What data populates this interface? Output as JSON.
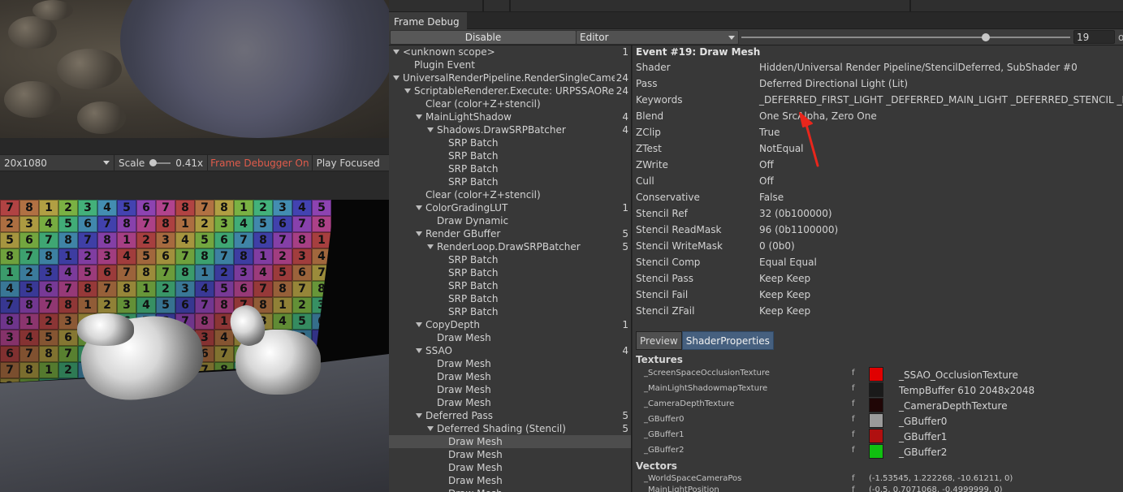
{
  "game_toolbar": {
    "resolution": "20x1080",
    "scale_label": "Scale",
    "scale_value": "0.41x",
    "frame_debugger_status": "Frame Debugger On",
    "play_mode": "Play Focused"
  },
  "wall_numbers": [
    "7",
    "8",
    "1",
    "2",
    "3",
    "4",
    "5",
    "6",
    "7",
    "8"
  ],
  "window": {
    "tab_title": "Frame Debug",
    "disable_label": "Disable",
    "target": "Editor",
    "event_index": "19",
    "event_count_fragment": "o"
  },
  "tree": [
    {
      "label": "<unknown scope>",
      "count": "1",
      "depth": 0,
      "arrow": true
    },
    {
      "label": "Plugin Event",
      "count": "",
      "depth": 1,
      "arrow": false
    },
    {
      "label": "UniversalRenderPipeline.RenderSingleCamera",
      "count": "24",
      "depth": 0,
      "arrow": true
    },
    {
      "label": "ScriptableRenderer.Execute: URPSSAORenderer",
      "count": "24",
      "depth": 1,
      "arrow": true
    },
    {
      "label": "Clear (color+Z+stencil)",
      "count": "",
      "depth": 2,
      "arrow": false
    },
    {
      "label": "MainLightShadow",
      "count": "4",
      "depth": 2,
      "arrow": true
    },
    {
      "label": "Shadows.DrawSRPBatcher",
      "count": "4",
      "depth": 3,
      "arrow": true
    },
    {
      "label": "SRP Batch",
      "count": "",
      "depth": 4,
      "arrow": false
    },
    {
      "label": "SRP Batch",
      "count": "",
      "depth": 4,
      "arrow": false
    },
    {
      "label": "SRP Batch",
      "count": "",
      "depth": 4,
      "arrow": false
    },
    {
      "label": "SRP Batch",
      "count": "",
      "depth": 4,
      "arrow": false
    },
    {
      "label": "Clear (color+Z+stencil)",
      "count": "",
      "depth": 2,
      "arrow": false
    },
    {
      "label": "ColorGradingLUT",
      "count": "1",
      "depth": 2,
      "arrow": true
    },
    {
      "label": "Draw Dynamic",
      "count": "",
      "depth": 3,
      "arrow": false
    },
    {
      "label": "Render GBuffer",
      "count": "5",
      "depth": 2,
      "arrow": true
    },
    {
      "label": "RenderLoop.DrawSRPBatcher",
      "count": "5",
      "depth": 3,
      "arrow": true
    },
    {
      "label": "SRP Batch",
      "count": "",
      "depth": 4,
      "arrow": false
    },
    {
      "label": "SRP Batch",
      "count": "",
      "depth": 4,
      "arrow": false
    },
    {
      "label": "SRP Batch",
      "count": "",
      "depth": 4,
      "arrow": false
    },
    {
      "label": "SRP Batch",
      "count": "",
      "depth": 4,
      "arrow": false
    },
    {
      "label": "SRP Batch",
      "count": "",
      "depth": 4,
      "arrow": false
    },
    {
      "label": "CopyDepth",
      "count": "1",
      "depth": 2,
      "arrow": true
    },
    {
      "label": "Draw Mesh",
      "count": "",
      "depth": 3,
      "arrow": false
    },
    {
      "label": "SSAO",
      "count": "4",
      "depth": 2,
      "arrow": true
    },
    {
      "label": "Draw Mesh",
      "count": "",
      "depth": 3,
      "arrow": false
    },
    {
      "label": "Draw Mesh",
      "count": "",
      "depth": 3,
      "arrow": false
    },
    {
      "label": "Draw Mesh",
      "count": "",
      "depth": 3,
      "arrow": false
    },
    {
      "label": "Draw Mesh",
      "count": "",
      "depth": 3,
      "arrow": false
    },
    {
      "label": "Deferred Pass",
      "count": "5",
      "depth": 2,
      "arrow": true
    },
    {
      "label": "Deferred Shading (Stencil)",
      "count": "5",
      "depth": 3,
      "arrow": true
    },
    {
      "label": "Draw Mesh",
      "count": "",
      "depth": 4,
      "arrow": false,
      "selected": true
    },
    {
      "label": "Draw Mesh",
      "count": "",
      "depth": 4,
      "arrow": false
    },
    {
      "label": "Draw Mesh",
      "count": "",
      "depth": 4,
      "arrow": false
    },
    {
      "label": "Draw Mesh",
      "count": "",
      "depth": 4,
      "arrow": false
    },
    {
      "label": "Draw Mesh",
      "count": "",
      "depth": 4,
      "arrow": false
    }
  ],
  "details": {
    "title": "Event #19: Draw Mesh",
    "properties": [
      {
        "key": "Shader",
        "value": "Hidden/Universal Render Pipeline/StencilDeferred, SubShader #0"
      },
      {
        "key": "Pass",
        "value": "Deferred Directional Light (Lit)"
      },
      {
        "key": "Keywords",
        "value": "_DEFERRED_FIRST_LIGHT _DEFERRED_MAIN_LIGHT _DEFERRED_STENCIL _DIR"
      },
      {
        "key": "Blend",
        "value": "One SrcAlpha, Zero One"
      },
      {
        "key": "ZClip",
        "value": "True"
      },
      {
        "key": "ZTest",
        "value": "NotEqual"
      },
      {
        "key": "ZWrite",
        "value": "Off"
      },
      {
        "key": "Cull",
        "value": "Off"
      },
      {
        "key": "Conservative",
        "value": "False"
      },
      {
        "key": "Stencil Ref",
        "value": "32 (0b100000)"
      },
      {
        "key": "Stencil ReadMask",
        "value": "96 (0b1100000)"
      },
      {
        "key": "Stencil WriteMask",
        "value": "0 (0b0)"
      },
      {
        "key": "Stencil Comp",
        "value": "Equal Equal"
      },
      {
        "key": "Stencil Pass",
        "value": "Keep Keep"
      },
      {
        "key": "Stencil Fail",
        "value": "Keep Keep"
      },
      {
        "key": "Stencil ZFail",
        "value": "Keep Keep"
      }
    ],
    "tab_preview": "Preview",
    "tab_shader_properties": "ShaderProperties",
    "textures_heading": "Textures",
    "textures": [
      {
        "name": "_ScreenSpaceOcclusionTexture",
        "flag": "f",
        "value": "_SSAO_OcclusionTexture",
        "swatch": "#e00000"
      },
      {
        "name": "_MainLightShadowmapTexture",
        "flag": "f",
        "value": "TempBuffer 610 2048x2048",
        "swatch": "#1a1a1a"
      },
      {
        "name": "_CameraDepthTexture",
        "flag": "f",
        "value": "_CameraDepthTexture",
        "swatch": "#200606"
      },
      {
        "name": "_GBuffer0",
        "flag": "f",
        "value": "_GBuffer0",
        "swatch": "#9a9a9a"
      },
      {
        "name": "_GBuffer1",
        "flag": "f",
        "value": "_GBuffer1",
        "swatch": "#b01010"
      },
      {
        "name": "_GBuffer2",
        "flag": "f",
        "value": "_GBuffer2",
        "swatch": "#10c010"
      }
    ],
    "vectors_heading": "Vectors",
    "vectors": [
      {
        "name": "_WorldSpaceCameraPos",
        "flag": "f",
        "value": "(-1.53545, 1.222268, -10.61211, 0)"
      },
      {
        "name": "_MainLightPosition",
        "flag": "f",
        "value": "(-0.5, 0.7071068, -0.4999999, 0)"
      }
    ]
  },
  "colors": {
    "panel_bg": "#383838",
    "selection": "#4d4d4d",
    "active_tab": "#46607f",
    "frame_debugger_on": "#e05b4b",
    "annotation_arrow": "#e8261c"
  }
}
